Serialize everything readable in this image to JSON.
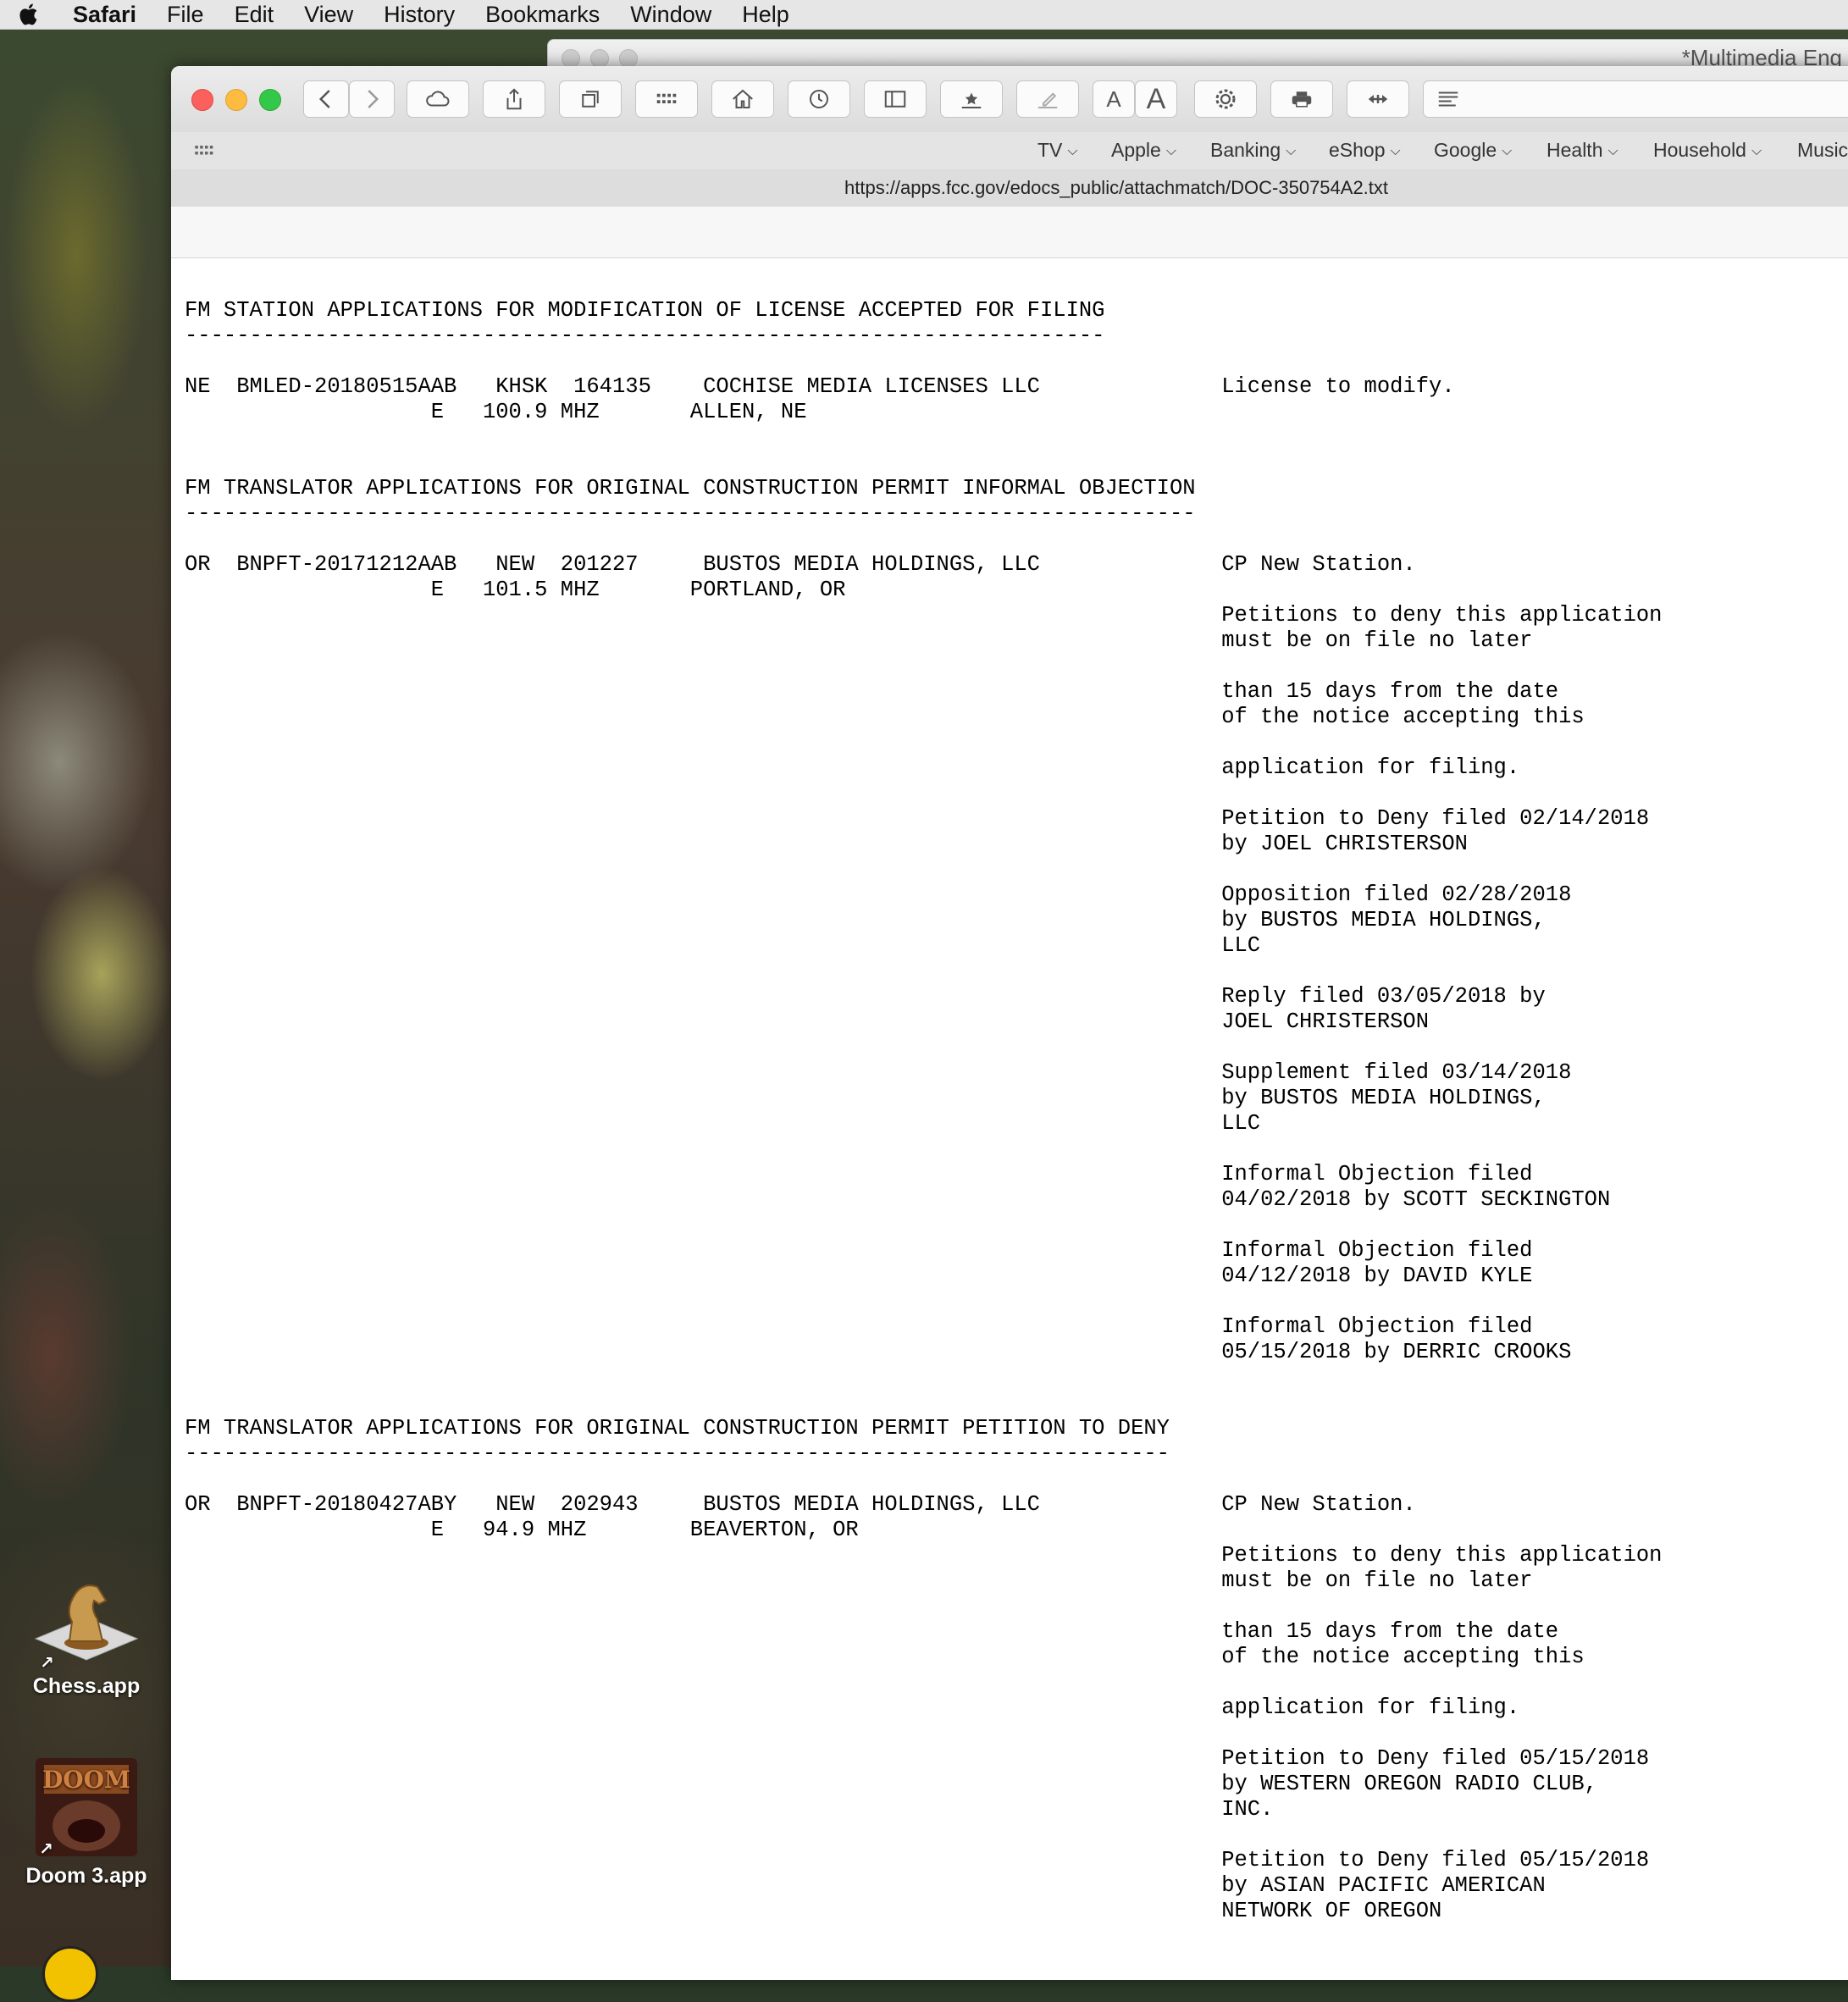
{
  "menubar": {
    "app": "Safari",
    "items": [
      "File",
      "Edit",
      "View",
      "History",
      "Bookmarks",
      "Window",
      "Help"
    ]
  },
  "background_window": {
    "title": "*Multimedia Eng"
  },
  "bookmarks": [
    "TV",
    "Apple",
    "Banking",
    "eShop",
    "Google",
    "Health",
    "Household",
    "Music"
  ],
  "url": "https://apps.fcc.gov/edocs_public/attachmatch/DOC-350754A2.txt",
  "toolbar": {
    "font_small": "A",
    "font_large": "A"
  },
  "document": {
    "lines": [
      "FM STATION APPLICATIONS FOR MODIFICATION OF LICENSE ACCEPTED FOR FILING",
      "-----------------------------------------------------------------------",
      "",
      "NE  BMLED-20180515AAB   KHSK  164135    COCHISE MEDIA LICENSES LLC              License to modify.",
      "                   E   100.9 MHZ       ALLEN, NE",
      "",
      "",
      "FM TRANSLATOR APPLICATIONS FOR ORIGINAL CONSTRUCTION PERMIT INFORMAL OBJECTION",
      "------------------------------------------------------------------------------",
      "",
      "OR  BNPFT-20171212AAB   NEW  201227     BUSTOS MEDIA HOLDINGS, LLC              CP New Station.",
      "                   E   101.5 MHZ       PORTLAND, OR",
      "                                                                                Petitions to deny this application",
      "                                                                                must be on file no later",
      "",
      "                                                                                than 15 days from the date",
      "                                                                                of the notice accepting this",
      "",
      "                                                                                application for filing.",
      "",
      "                                                                                Petition to Deny filed 02/14/2018",
      "                                                                                by JOEL CHRISTERSON",
      "",
      "                                                                                Opposition filed 02/28/2018",
      "                                                                                by BUSTOS MEDIA HOLDINGS,",
      "                                                                                LLC",
      "",
      "                                                                                Reply filed 03/05/2018 by",
      "                                                                                JOEL CHRISTERSON",
      "",
      "                                                                                Supplement filed 03/14/2018",
      "                                                                                by BUSTOS MEDIA HOLDINGS,",
      "                                                                                LLC",
      "",
      "                                                                                Informal Objection filed",
      "                                                                                04/02/2018 by SCOTT SECKINGTON",
      "",
      "                                                                                Informal Objection filed",
      "                                                                                04/12/2018 by DAVID KYLE",
      "",
      "                                                                                Informal Objection filed",
      "                                                                                05/15/2018 by DERRIC CROOKS",
      "",
      "",
      "FM TRANSLATOR APPLICATIONS FOR ORIGINAL CONSTRUCTION PERMIT PETITION TO DENY",
      "----------------------------------------------------------------------------",
      "",
      "OR  BNPFT-20180427ABY   NEW  202943     BUSTOS MEDIA HOLDINGS, LLC              CP New Station.",
      "                   E   94.9 MHZ        BEAVERTON, OR",
      "                                                                                Petitions to deny this application",
      "                                                                                must be on file no later",
      "",
      "                                                                                than 15 days from the date",
      "                                                                                of the notice accepting this",
      "",
      "                                                                                application for filing.",
      "",
      "                                                                                Petition to Deny filed 05/15/2018",
      "                                                                                by WESTERN OREGON RADIO CLUB,",
      "                                                                                INC.",
      "",
      "                                                                                Petition to Deny filed 05/15/2018",
      "                                                                                by ASIAN PACIFIC AMERICAN",
      "                                                                                NETWORK OF OREGON"
    ]
  },
  "desktop_icons": [
    {
      "label": "Chess.app",
      "icon": "chess-knight-icon"
    },
    {
      "label": "Doom 3.app",
      "icon": "doom3-app-icon"
    }
  ]
}
